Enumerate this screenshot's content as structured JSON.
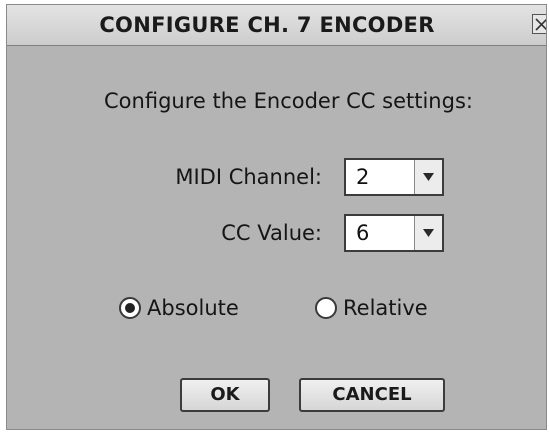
{
  "dialog": {
    "title": "CONFIGURE CH. 7 ENCODER",
    "close_icon": "close-icon",
    "prompt": "Configure the Encoder CC settings:"
  },
  "fields": {
    "midi_channel": {
      "label": "MIDI Channel:",
      "value": "2"
    },
    "cc_value": {
      "label": "CC Value:",
      "value": "6"
    }
  },
  "mode": {
    "options": [
      {
        "label": "Absolute",
        "selected": true
      },
      {
        "label": "Relative",
        "selected": false
      }
    ]
  },
  "buttons": {
    "ok": "OK",
    "cancel": "CANCEL"
  }
}
